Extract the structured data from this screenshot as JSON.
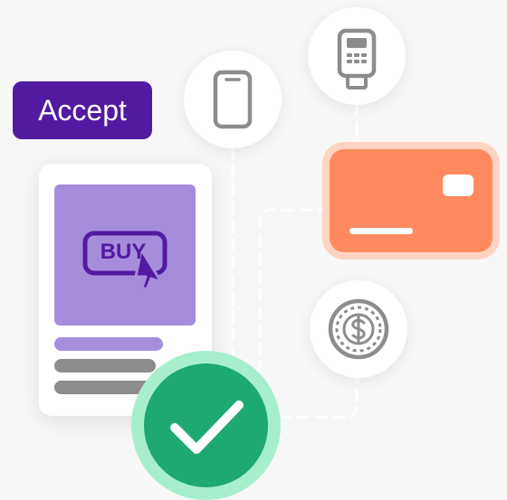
{
  "accept_button": {
    "label": "Accept",
    "background": "#521aa0",
    "text_color": "#ffffff"
  },
  "product_card": {
    "image_color": "#a58ddc",
    "buy_label": "BUY",
    "icons": [
      "buy-badge-icon",
      "cursor-icon"
    ]
  },
  "payment_methods": {
    "icons": [
      "phone-icon",
      "card-terminal-icon",
      "credit-card-icon",
      "dollar-coin-icon"
    ],
    "card_color": "#ff8a5f"
  },
  "success": {
    "icon": "checkmark-icon",
    "color": "#1ea872"
  }
}
